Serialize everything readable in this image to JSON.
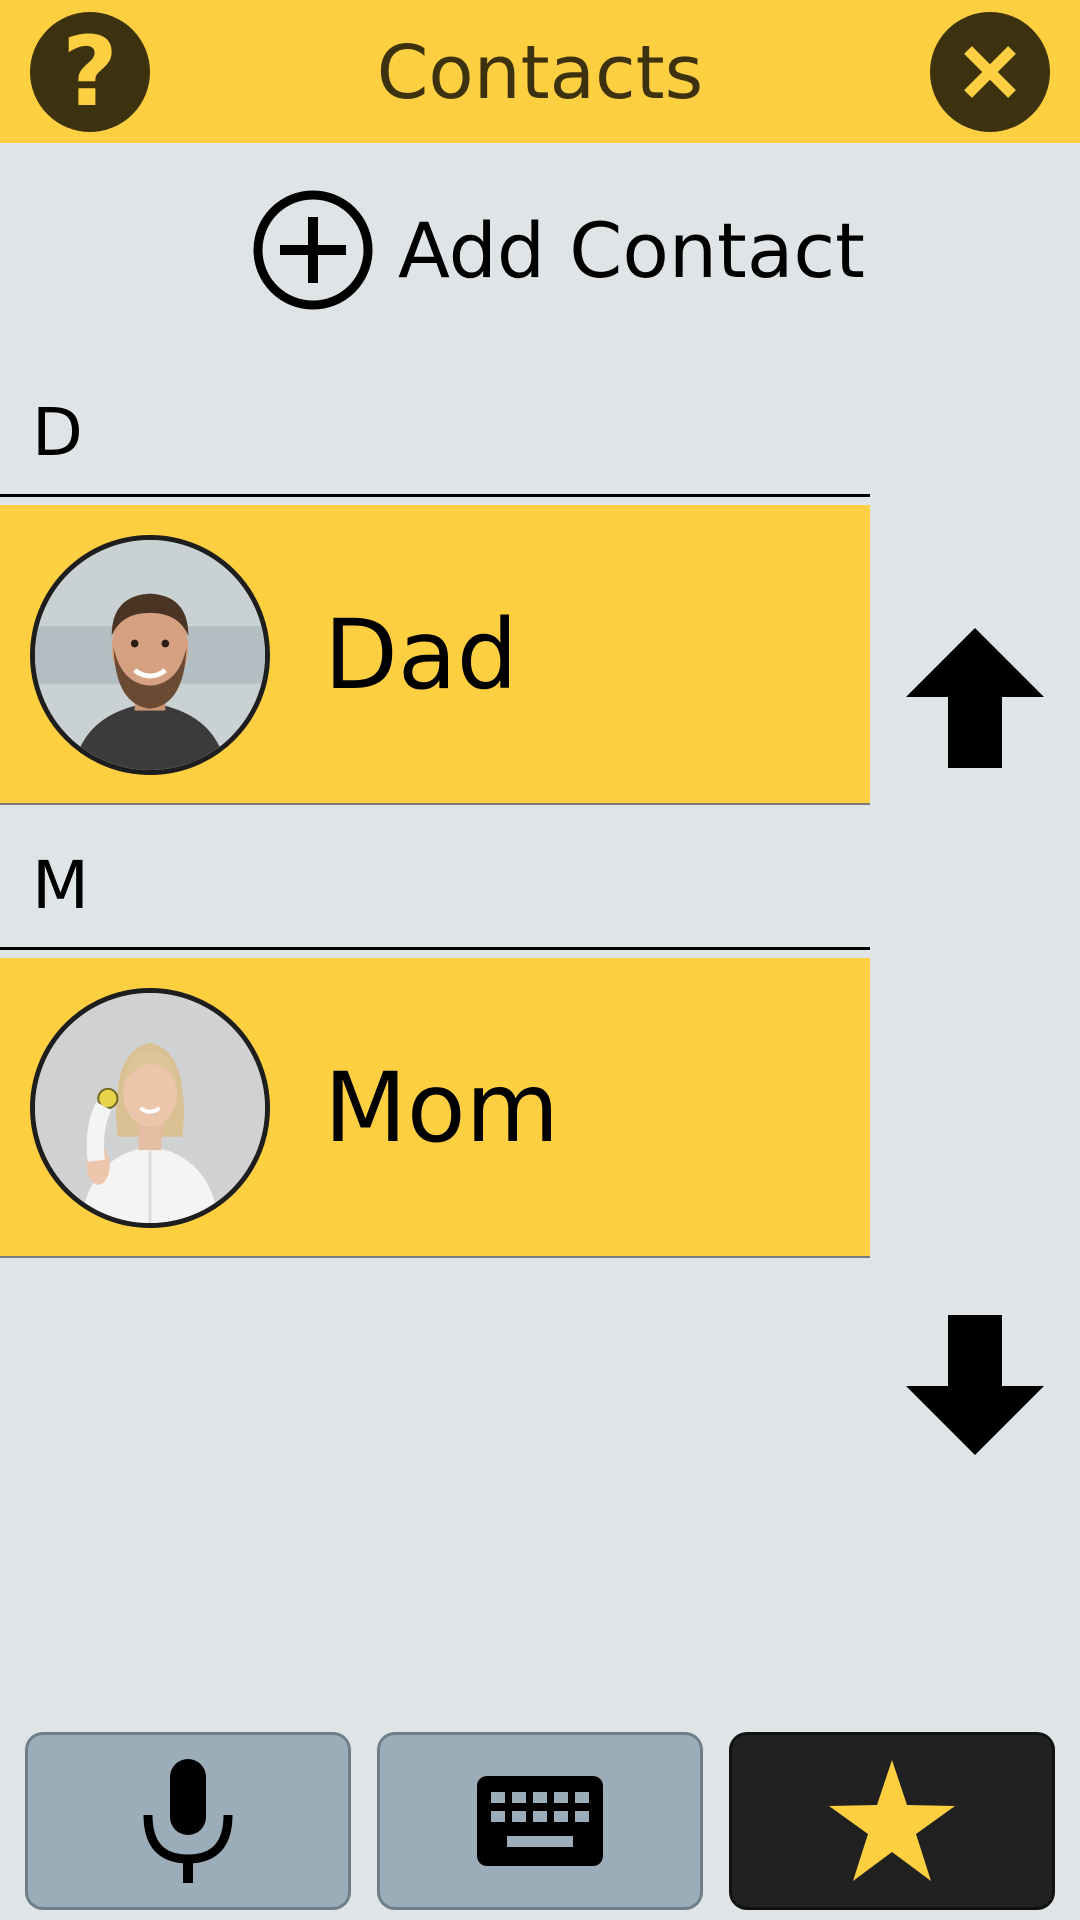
{
  "header": {
    "title": "Contacts",
    "help_icon": "question-mark-icon",
    "close_icon": "close-icon"
  },
  "add_contact": {
    "label": "Add Contact",
    "icon": "plus-circle-icon"
  },
  "sections": [
    {
      "letter": "D",
      "contacts": [
        {
          "name": "Dad",
          "avatar": "photo-bearded-man"
        }
      ]
    },
    {
      "letter": "M",
      "contacts": [
        {
          "name": "Mom",
          "avatar": "photo-blonde-woman"
        }
      ]
    }
  ],
  "scroll": {
    "up_icon": "arrow-up-icon",
    "down_icon": "arrow-down-icon"
  },
  "bottom_bar": [
    {
      "icon": "microphone-icon"
    },
    {
      "icon": "keyboard-icon"
    },
    {
      "icon": "star-icon"
    }
  ],
  "colors": {
    "accent": "#fecf40",
    "background": "#dfe4e6",
    "header_icon_bg": "#3d3210",
    "bottom_button": "#9badb8",
    "favorite_button": "#212121"
  }
}
